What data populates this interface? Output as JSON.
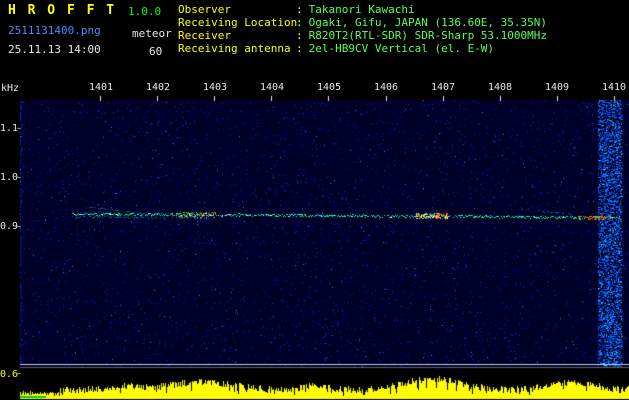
{
  "header": {
    "app_title": "H R O F F T",
    "version": "1.0.0",
    "filename": "2511131400.png",
    "mode": "meteor",
    "datetime": "25.11.13 14:00",
    "duration": "60",
    "info": [
      {
        "label": "Observer",
        "sep": ":",
        "value": "Takanori Kawachi"
      },
      {
        "label": "Receiving Location",
        "sep": ":",
        "value": "Ogaki, Gifu, JAPAN (136.60E, 35.35N)"
      },
      {
        "label": "Receiver",
        "sep": ":",
        "value": "R820T2(RTL-SDR) SDR-Sharp 53.1000MHz"
      },
      {
        "label": "Receiving antenna",
        "sep": ":",
        "value": "2el-HB9CV Vertical (el. E-W)"
      }
    ]
  },
  "chart_data": {
    "type": "heatmap",
    "title": "",
    "ylabel": "kHz",
    "xlabel": "",
    "x_ticks": [
      "1401",
      "1402",
      "1403",
      "1404",
      "1405",
      "1406",
      "1407",
      "1408",
      "1409",
      "1410"
    ],
    "y_ticks": [
      "1.1",
      "1.0",
      "0.9",
      "0.6"
    ],
    "y_range_khz": [
      0.6,
      1.2
    ],
    "carrier_trace": {
      "freq_khz": 0.92,
      "from": "1401",
      "to": "1410",
      "bright_bursts_near": [
        "1402.5",
        "1407",
        "1409.8"
      ]
    },
    "broadband_band": {
      "near": "1410",
      "appearance": "bright blue vertical band at right edge"
    },
    "level_plot": {
      "appearance": "yellow audio level strip at bottom",
      "peaks_near": [
        "1402-1403",
        "1407",
        "1409-1410"
      ]
    }
  },
  "colors": {
    "title_yellow": "#ffff00",
    "version_green": "#00ff00",
    "filename_blue": "#4d8aff",
    "text_white": "#e8e8e8",
    "value_green": "#58ff58",
    "noise_bg": "#000026",
    "noise_dots": [
      "#000052",
      "#000078",
      "#1a1aa0",
      "#0040c0",
      "#00a0e0"
    ],
    "band_blue": "#0066ff",
    "trace_green": "#00ff66",
    "trace_cyan": "#00ffee",
    "trace_red": "#ff3300",
    "trace_orange": "#ff8800",
    "level_yellow": "#ffff00",
    "axis_white": "#e8e8e8",
    "separator_line": "#c8c8d8",
    "min_green": "#00cc33"
  }
}
